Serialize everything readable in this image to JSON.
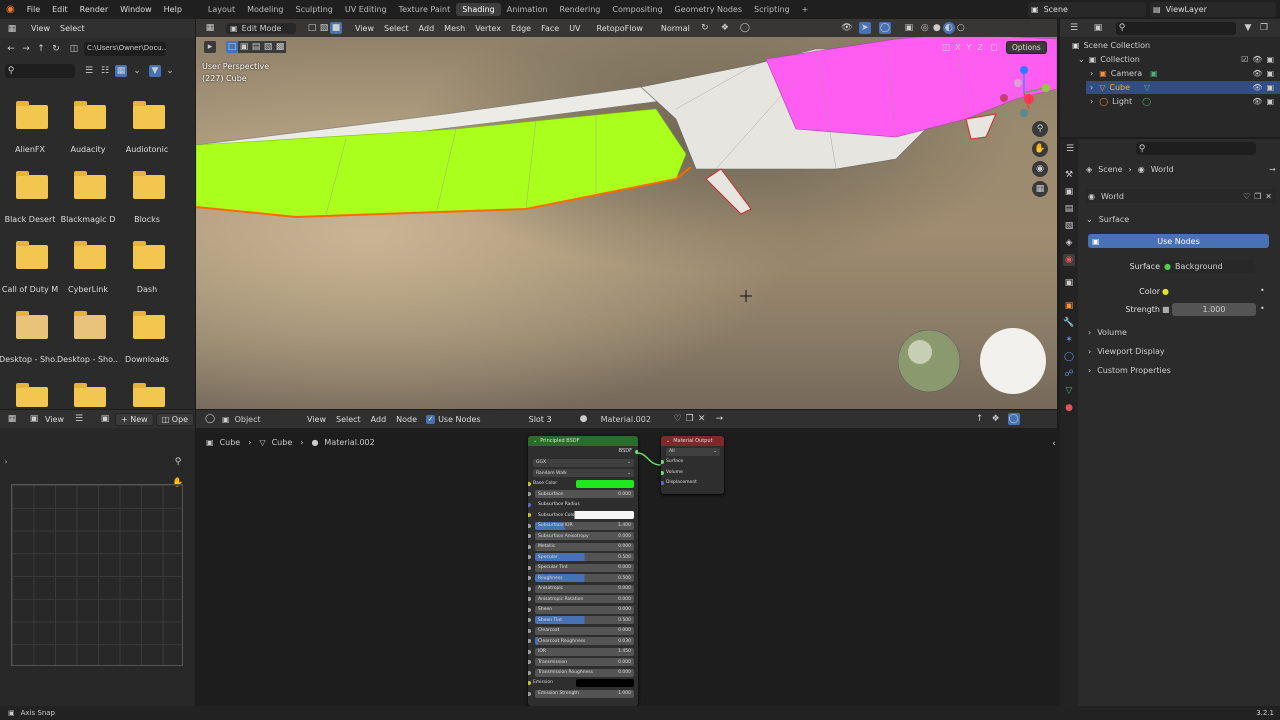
{
  "topbar": {
    "menus": [
      "File",
      "Edit",
      "Render",
      "Window",
      "Help"
    ],
    "workspaces": [
      "Layout",
      "Modeling",
      "Sculpting",
      "UV Editing",
      "Texture Paint",
      "Shading",
      "Animation",
      "Rendering",
      "Compositing",
      "Geometry Nodes",
      "Scripting"
    ],
    "active_workspace": "Shading",
    "add_tab": "+",
    "scene": "Scene",
    "view_layer": "ViewLayer"
  },
  "filebrowser": {
    "menus": [
      "View",
      "Select"
    ],
    "path": "C:\\Users\\Owner\\Docu...",
    "folders": [
      "AlienFX",
      "Audacity",
      "Audiotonic",
      "Black Desert",
      "Blackmagic D",
      "Blocks",
      "Call of Duty M",
      "CyberLink",
      "Dash",
      "Desktop - Sho...",
      "Desktop - Sho...",
      "Downloads"
    ]
  },
  "viewport": {
    "mode": "Edit Mode",
    "menus": [
      "View",
      "Select",
      "Add",
      "Mesh",
      "Vertex",
      "Edge",
      "Face",
      "UV"
    ],
    "retopo": "RetopoFlow",
    "orientation": "Normal",
    "overlay_info": [
      "User Perspective",
      "(227) Cube"
    ],
    "axes": [
      "X",
      "Y",
      "Z"
    ],
    "options": "Options",
    "colors": {
      "face_green": "#aaff1c",
      "face_pink": "#ff5cf2"
    }
  },
  "image_editor": {
    "menus": [
      "View"
    ],
    "new": "New",
    "open": "Ope"
  },
  "node_editor": {
    "type": "Object",
    "menus": [
      "View",
      "Select",
      "Add",
      "Node"
    ],
    "use_nodes": "Use Nodes",
    "slot": "Slot 3",
    "material": "Material.002",
    "breadcrumb": [
      "Cube",
      "Cube",
      "Material.002"
    ]
  },
  "bsdf": {
    "title": "Principled BSDF",
    "output": "BSDF",
    "distribution": "GGX",
    "subsurface_method": "Random Walk",
    "base_color_label": "Base Color",
    "base_color": "#1fe81f",
    "rows": [
      {
        "label": "Subsurface",
        "value": "0.000",
        "fill": 0
      },
      {
        "label": "Subsurface Radius",
        "value": "",
        "fill": 0
      },
      {
        "label": "Subsurface Color",
        "value": "",
        "fill": 0
      },
      {
        "label": "Subsurface IOR",
        "value": "1.400",
        "fill": 0.3
      },
      {
        "label": "Subsurface Anisotropy",
        "value": "0.000",
        "fill": 0
      },
      {
        "label": "Metallic",
        "value": "0.000",
        "fill": 0
      },
      {
        "label": "Specular",
        "value": "0.500",
        "fill": 0.5
      },
      {
        "label": "Specular Tint",
        "value": "0.000",
        "fill": 0
      },
      {
        "label": "Roughness",
        "value": "0.500",
        "fill": 0.5
      },
      {
        "label": "Anisotropic",
        "value": "0.000",
        "fill": 0
      },
      {
        "label": "Anisotropic Rotation",
        "value": "0.000",
        "fill": 0
      },
      {
        "label": "Sheen",
        "value": "0.000",
        "fill": 0
      },
      {
        "label": "Sheen Tint",
        "value": "0.500",
        "fill": 0.5
      },
      {
        "label": "Clearcoat",
        "value": "0.000",
        "fill": 0
      },
      {
        "label": "Clearcoat Roughness",
        "value": "0.030",
        "fill": 0.03
      },
      {
        "label": "IOR",
        "value": "1.450",
        "fill": 0
      },
      {
        "label": "Transmission",
        "value": "0.000",
        "fill": 0
      },
      {
        "label": "Transmission Roughness",
        "value": "0.000",
        "fill": 0
      }
    ],
    "emission": "Emission",
    "emission_strength": "Emission Strength",
    "emission_strength_value": "1.000"
  },
  "matout": {
    "title": "Material Output",
    "target": "All",
    "sockets": [
      "Surface",
      "Volume",
      "Displacement"
    ]
  },
  "outliner": {
    "root": "Scene Collection",
    "collection": "Collection",
    "items": [
      "Camera",
      "Cube",
      "Light"
    ]
  },
  "properties": {
    "breadcrumb": [
      "Scene",
      "World"
    ],
    "world": "World",
    "surface_panel": "Surface",
    "use_nodes": "Use Nodes",
    "surface_label": "Surface",
    "surface_value": "Background",
    "color_label": "Color",
    "strength_label": "Strength",
    "strength_value": "1.000",
    "panels": [
      "Volume",
      "Viewport Display",
      "Custom Properties"
    ]
  },
  "status": {
    "left": "Axis Snap",
    "version": "3.2.1"
  }
}
